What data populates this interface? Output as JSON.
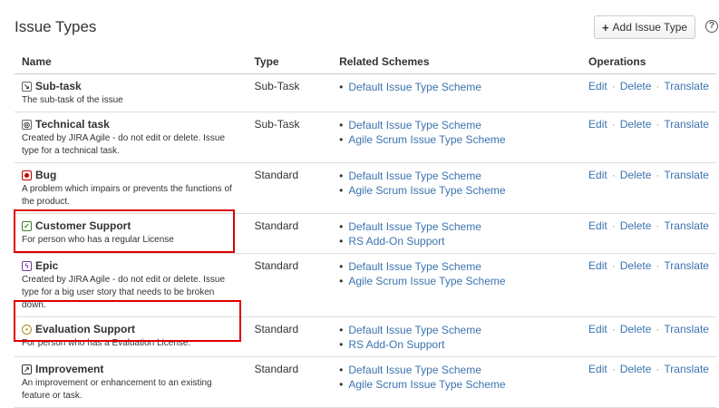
{
  "page": {
    "title": "Issue Types",
    "add_button_label": "Add Issue Type",
    "help_icon_glyph": "?"
  },
  "table": {
    "headers": {
      "name": "Name",
      "type": "Type",
      "schemes": "Related Schemes",
      "operations": "Operations"
    },
    "ops": {
      "edit": "Edit",
      "delete": "Delete",
      "translate": "Translate",
      "separator": "·"
    },
    "rows": [
      {
        "icon": "subtask-icon",
        "name": "Sub-task",
        "description": "The sub-task of the issue",
        "type": "Sub-Task",
        "schemes": [
          "Default Issue Type Scheme"
        ]
      },
      {
        "icon": "technical-task-icon",
        "name": "Technical task",
        "description": "Created by JIRA Agile - do not edit or delete. Issue type for a technical task.",
        "type": "Sub-Task",
        "schemes": [
          "Default Issue Type Scheme",
          "Agile Scrum Issue Type Scheme"
        ]
      },
      {
        "icon": "bug-icon",
        "name": "Bug",
        "description": "A problem which impairs or prevents the functions of the product.",
        "type": "Standard",
        "schemes": [
          "Default Issue Type Scheme",
          "Agile Scrum Issue Type Scheme"
        ]
      },
      {
        "icon": "customer-support-icon",
        "name": "Customer Support",
        "description": "For person who has a regular License",
        "type": "Standard",
        "schemes": [
          "Default Issue Type Scheme",
          "RS Add-On Support"
        ]
      },
      {
        "icon": "epic-icon",
        "name": "Epic",
        "description": "Created by JIRA Agile - do not edit or delete. Issue type for a big user story that needs to be broken down.",
        "type": "Standard",
        "schemes": [
          "Default Issue Type Scheme",
          "Agile Scrum Issue Type Scheme"
        ]
      },
      {
        "icon": "evaluation-support-icon",
        "name": "Evaluation Support",
        "description": "For person who has a Evaluation License.",
        "type": "Standard",
        "schemes": [
          "Default Issue Type Scheme",
          "RS Add-On Support"
        ]
      },
      {
        "icon": "improvement-icon",
        "name": "Improvement",
        "description": "An improvement or enhancement to an existing feature or task.",
        "type": "Standard",
        "schemes": [
          "Default Issue Type Scheme",
          "Agile Scrum Issue Type Scheme"
        ]
      }
    ]
  },
  "colors": {
    "link": "#3b73af",
    "highlight": "#e00000",
    "bug": "#cc0000"
  }
}
